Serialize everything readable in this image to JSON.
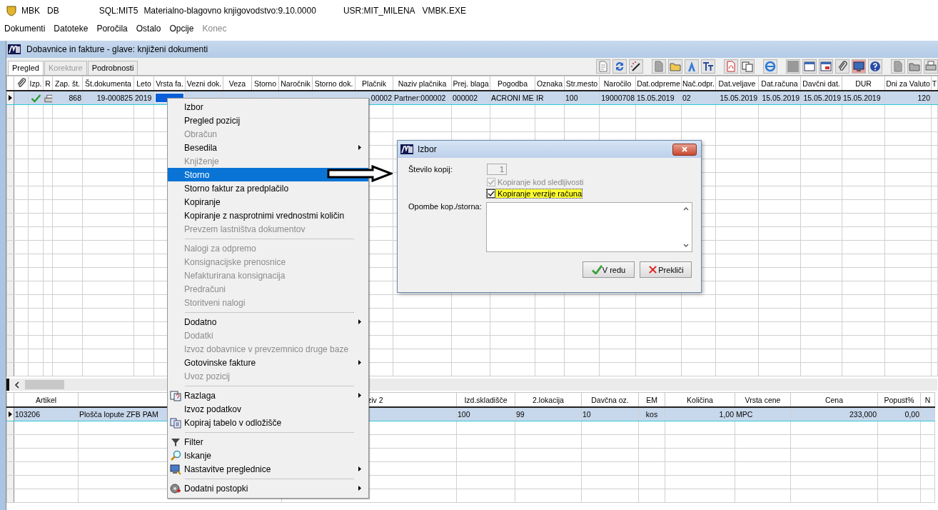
{
  "app_bar": {
    "app": "MBK",
    "db": "DB",
    "sql": "SQL:MIT5",
    "product": "Materialno-blagovno knjigovodstvo:9.10.0000",
    "user": "USR:MIT_MILENA",
    "exe": "VMBK.EXE"
  },
  "menu_bar": [
    {
      "label": "Dokumenti",
      "disabled": false
    },
    {
      "label": "Datoteke",
      "disabled": false
    },
    {
      "label": "Poročila",
      "disabled": false
    },
    {
      "label": "Ostalo",
      "disabled": false
    },
    {
      "label": "Opcije",
      "disabled": false
    },
    {
      "label": "Konec",
      "disabled": true
    }
  ],
  "window": {
    "title": "Dobavnice in fakture - glave: knjiženi dokumenti"
  },
  "tabs": [
    {
      "label": "Pregled",
      "selected": true,
      "disabled": false
    },
    {
      "label": "Korekture",
      "selected": false,
      "disabled": true
    },
    {
      "label": "Podrobnosti",
      "selected": false,
      "disabled": false
    }
  ],
  "upper_table": {
    "columns": [
      "Izp.",
      "R",
      "Zap. št.",
      "Št.dokumenta",
      "Leto",
      "Vrsta fa.",
      "Vezni dok.",
      "Veza",
      "Storno",
      "Naročnik",
      "Storno dok.",
      "Plačnik",
      "Naziv plačnika",
      "Prej. blaga",
      "Pogodba",
      "Oznaka",
      "Str.mesto",
      "Naročilo",
      "Dat.odpreme",
      "Nač.odpr.",
      "Dat.veljave",
      "Dat.računa",
      "Davčni dat.",
      "DUR",
      "Dni za Valuto",
      "T"
    ],
    "rows": [
      {
        "selected": true,
        "cells": [
          {
            "kind": "check"
          },
          {
            "kind": "printer"
          },
          {
            "text": "868"
          },
          {
            "text": "19-000825"
          },
          {
            "text": "2019"
          },
          {
            "kind": "focused"
          },
          {},
          {},
          {},
          {},
          {},
          {
            "text": "00002"
          },
          {
            "text": "Partner:000002"
          },
          {
            "text": "000002"
          },
          {
            "text": "ACRONI ME"
          },
          {
            "text": "IR"
          },
          {
            "text": "100"
          },
          {
            "text": "19000708"
          },
          {
            "text": "15.05.2019"
          },
          {
            "text": "02"
          },
          {
            "text": "15.05.2019"
          },
          {
            "text": "15.05.2019"
          },
          {
            "text": "15.05.2019"
          },
          {
            "text": "15.05.2019"
          },
          {
            "text": "120"
          },
          {}
        ]
      }
    ]
  },
  "lower_table": {
    "columns": [
      "Artikel",
      null,
      "ziv 2",
      "Izd.skladišče",
      "2.lokacija",
      "Davčna oz.",
      "EM",
      "Količina",
      "Vrsta cene",
      "Cena",
      "Popust%",
      "N"
    ],
    "rows": [
      {
        "selected": true,
        "cells": [
          "103206",
          "Plošča lopute ZFB PAM",
          null,
          "100",
          "99",
          "10",
          "kos",
          "1,00",
          "MPC",
          "233,000",
          "0,00",
          null
        ]
      }
    ]
  },
  "context_menu": [
    [
      {
        "label": "Izbor",
        "disabled": false,
        "submenu": false,
        "selected": false
      },
      {
        "label": "Pregled pozicij",
        "disabled": false,
        "submenu": false,
        "selected": false
      },
      {
        "label": "Obračun",
        "disabled": true,
        "submenu": false,
        "selected": false
      },
      {
        "label": "Besedila",
        "disabled": false,
        "submenu": true,
        "selected": false
      },
      {
        "label": "Knjiženje",
        "disabled": true,
        "submenu": false,
        "selected": false
      },
      {
        "label": "Storno",
        "disabled": false,
        "submenu": false,
        "selected": true
      },
      {
        "label": "Storno faktur za predplačilo",
        "disabled": false,
        "submenu": false,
        "selected": false
      },
      {
        "label": "Kopiranje",
        "disabled": false,
        "submenu": false,
        "selected": false
      },
      {
        "label": "Kopiranje z nasprotnimi vrednostmi količin",
        "disabled": false,
        "submenu": false,
        "selected": false
      },
      {
        "label": "Prevzem lastništva dokumentov",
        "disabled": true,
        "submenu": false,
        "selected": false
      }
    ],
    [
      {
        "label": "Nalogi za odpremo",
        "disabled": true,
        "submenu": false,
        "selected": false
      },
      {
        "label": "Konsignacijske prenosnice",
        "disabled": true,
        "submenu": false,
        "selected": false
      },
      {
        "label": "Nefakturirana konsignacija",
        "disabled": true,
        "submenu": false,
        "selected": false
      },
      {
        "label": "Predračuni",
        "disabled": true,
        "submenu": false,
        "selected": false
      },
      {
        "label": "Storitveni nalogi",
        "disabled": true,
        "submenu": false,
        "selected": false
      }
    ],
    [
      {
        "label": "Dodatno",
        "disabled": false,
        "submenu": true,
        "selected": false
      },
      {
        "label": "Dodatki",
        "disabled": true,
        "submenu": false,
        "selected": false
      },
      {
        "label": "Izvoz dobavnice v prevzemnico druge baze",
        "disabled": true,
        "submenu": false,
        "selected": false
      },
      {
        "label": "Gotovinske fakture",
        "disabled": false,
        "submenu": true,
        "selected": false
      },
      {
        "label": "Uvoz pozicij",
        "disabled": true,
        "submenu": false,
        "selected": false
      }
    ],
    [
      {
        "label": "Razlaga",
        "disabled": false,
        "submenu": true,
        "selected": false,
        "kind": "help"
      },
      {
        "label": "Izvoz podatkov",
        "disabled": false,
        "submenu": false,
        "selected": false,
        "kind": "plain"
      },
      {
        "label": "Kopiraj tabelo v odložišče",
        "disabled": false,
        "submenu": false,
        "selected": false,
        "kind": "copy"
      }
    ],
    [
      {
        "label": "Filter",
        "disabled": false,
        "submenu": false,
        "selected": false,
        "kind": "filter"
      },
      {
        "label": "Iskanje",
        "disabled": false,
        "submenu": false,
        "selected": false,
        "kind": "search"
      },
      {
        "label": "Nastavitve preglednice",
        "disabled": false,
        "submenu": true,
        "selected": false,
        "kind": "settings"
      }
    ],
    [
      {
        "label": "Dodatni postopki",
        "disabled": false,
        "submenu": true,
        "selected": false,
        "kind": "gears"
      }
    ]
  ],
  "dialog": {
    "title": "Izbor",
    "copies_label": "Število kopij:",
    "copies_value": "1",
    "copies_disabled": true,
    "checkboxes": [
      {
        "label": "Kopiranje kod sledljivosti",
        "checked": true,
        "disabled": true,
        "focused": false
      },
      {
        "label": "Kopiranje verzije računa",
        "checked": true,
        "disabled": false,
        "focused": true
      }
    ],
    "notes_label": "Opombe kop./storna:",
    "buttons": [
      {
        "label": "V redu",
        "kind": "ok"
      },
      {
        "label": "Prekliči",
        "kind": "cancel"
      }
    ]
  }
}
